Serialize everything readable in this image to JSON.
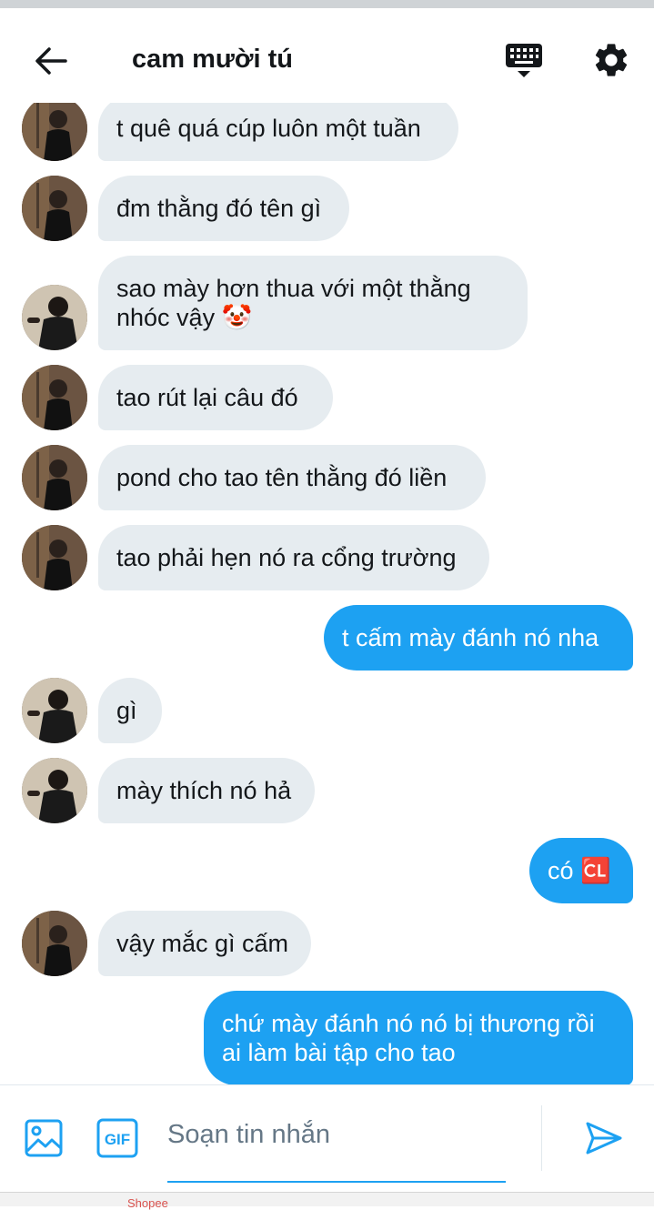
{
  "header": {
    "title": "cam mười tú",
    "icons": {
      "back": "arrow-left-icon",
      "keyboard": "keyboard-icon",
      "settings": "gear-icon"
    }
  },
  "messages": [
    {
      "side": "in",
      "text": "t quê quá cúp luôn một tuần",
      "avatar": "avatar-a"
    },
    {
      "side": "in",
      "text": "đm thằng đó tên gì",
      "avatar": "avatar-a"
    },
    {
      "side": "in",
      "text": "sao mày hơn thua với một thằng\nnhóc vậy 🤡",
      "avatar": "avatar-b"
    },
    {
      "side": "in",
      "text": "tao rút lại câu đó",
      "avatar": "avatar-a"
    },
    {
      "side": "in",
      "text": "pond cho tao tên thằng đó liền",
      "avatar": "avatar-a"
    },
    {
      "side": "in",
      "text": "tao phải hẹn nó ra cổng trường",
      "avatar": "avatar-a"
    },
    {
      "side": "out",
      "text": "t cấm mày đánh nó nha"
    },
    {
      "side": "in",
      "text": "gì",
      "avatar": "avatar-b"
    },
    {
      "side": "in",
      "text": "mày thích nó hả",
      "avatar": "avatar-b"
    },
    {
      "side": "out",
      "text": "có 🆑"
    },
    {
      "side": "in",
      "text": "vậy mắc gì cấm",
      "avatar": "avatar-a"
    },
    {
      "side": "out",
      "text": "chứ mày đánh nó nó bị thương rồi\nai làm bài tập cho tao"
    }
  ],
  "composer": {
    "placeholder": "Soạn tin nhắn",
    "value": "",
    "gif_label": "GIF",
    "icons": {
      "image": "image-icon",
      "gif": "gif-icon",
      "send": "send-icon"
    }
  },
  "bottom_bar": {
    "partial_text": "Shopee"
  },
  "colors": {
    "accent": "#1da1f2",
    "incoming_bubble": "#e6ecf0",
    "text": "#14171a",
    "placeholder": "#657786"
  }
}
